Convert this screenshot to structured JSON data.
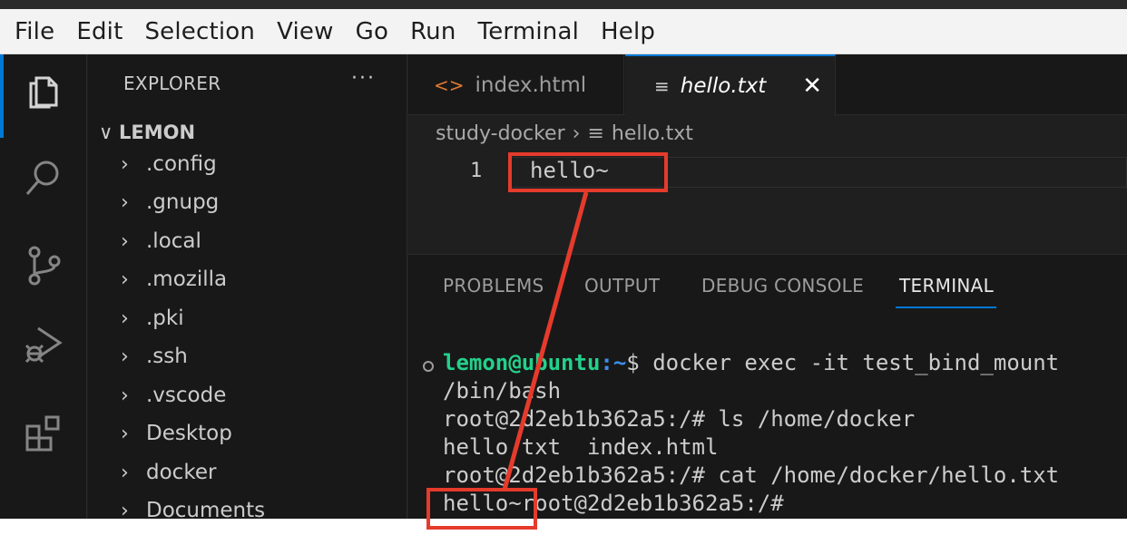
{
  "menubar": {
    "items": [
      "File",
      "Edit",
      "Selection",
      "View",
      "Go",
      "Run",
      "Terminal",
      "Help"
    ]
  },
  "activity_bar": {
    "icons": [
      "files-icon",
      "search-icon",
      "source-control-icon",
      "run-debug-icon",
      "extensions-icon"
    ]
  },
  "sidebar": {
    "title": "EXPLORER",
    "more": "···",
    "root": "LEMON",
    "items": [
      ".config",
      ".gnupg",
      ".local",
      ".mozilla",
      ".pki",
      ".ssh",
      ".vscode",
      "Desktop",
      "docker",
      "Documents"
    ]
  },
  "tabs": [
    {
      "label": "index.html",
      "icon": "html-file-icon",
      "active": false
    },
    {
      "label": "hello.txt",
      "icon": "text-file-icon",
      "active": true
    }
  ],
  "breadcrumb": {
    "folder": "study-docker",
    "file": "hello.txt"
  },
  "editor": {
    "line_number": "1",
    "line_text": "hello~"
  },
  "panel": {
    "tabs": [
      "PROBLEMS",
      "OUTPUT",
      "DEBUG CONSOLE",
      "TERMINAL"
    ],
    "active_tab": "TERMINAL"
  },
  "terminal": {
    "prompt_user": "lemon@ubuntu",
    "prompt_path": ":~",
    "prompt_symbol": "$ ",
    "command1": "docker exec -it test_bind_mount",
    "command1_cont": "/bin/bash",
    "line3": "root@2d2eb1b362a5:/# ls /home/docker",
    "line4": "hello.txt  index.html",
    "line5": "root@2d2eb1b362a5:/# cat /home/docker/hello.txt",
    "line6_output": "hello~",
    "line6_prompt": "root@2d2eb1b362a5:/#"
  },
  "colors": {
    "annotation": "#e53b2c",
    "accent": "#0078d4",
    "prompt_green": "#23d18b",
    "prompt_blue": "#3b8eea"
  }
}
